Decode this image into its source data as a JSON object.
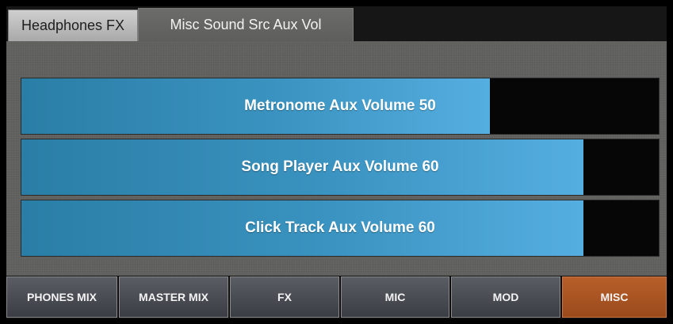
{
  "tabs": [
    {
      "label": "Headphones FX",
      "active": false
    },
    {
      "label": "Misc Sound Src Aux Vol",
      "active": true
    }
  ],
  "sliders": [
    {
      "label": "Metronome Aux Volume 50",
      "value": 50
    },
    {
      "label": "Song Player Aux Volume 60",
      "value": 60
    },
    {
      "label": "Click Track Aux Volume 60",
      "value": 60
    }
  ],
  "bottom_buttons": [
    {
      "label": "PHONES MIX",
      "selected": false
    },
    {
      "label": "MASTER MIX",
      "selected": false
    },
    {
      "label": "FX",
      "selected": false
    },
    {
      "label": "MIC",
      "selected": false
    },
    {
      "label": "MOD",
      "selected": false
    },
    {
      "label": "MISC",
      "selected": true
    }
  ],
  "colors": {
    "slider_fill": "#3a93c0",
    "selected_button": "#b85f2a",
    "panel": "#61615f"
  }
}
